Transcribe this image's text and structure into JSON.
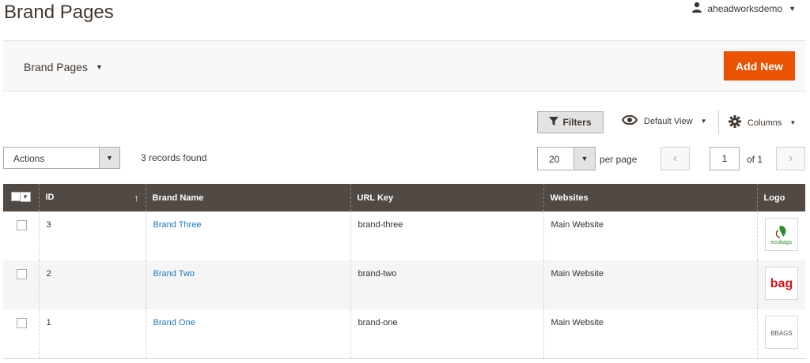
{
  "header": {
    "title": "Brand Pages",
    "username": "aheadworksdemo"
  },
  "page_actions": {
    "store_switcher_label": "Brand Pages",
    "add_new_label": "Add New"
  },
  "toolbar": {
    "filters_label": "Filters",
    "view_label": "Default View",
    "columns_label": "Columns",
    "actions_label": "Actions",
    "records_found": "3 records found",
    "per_page_value": "20",
    "per_page_label": "per page",
    "current_page": "1",
    "total_pages_label": "of 1"
  },
  "grid": {
    "columns": [
      "ID",
      "Brand Name",
      "URL Key",
      "Websites",
      "Logo"
    ],
    "rows": [
      {
        "id": "3",
        "brand_name": "Brand Three",
        "url_key": "brand-three",
        "websites": "Main Website",
        "logo_text": "ecobags"
      },
      {
        "id": "2",
        "brand_name": "Brand Two",
        "url_key": "brand-two",
        "websites": "Main Website",
        "logo_text": "bag"
      },
      {
        "id": "1",
        "brand_name": "Brand One",
        "url_key": "brand-one",
        "websites": "Main Website",
        "logo_text": "BBAGS"
      }
    ]
  },
  "colors": {
    "accent": "#eb5202",
    "grid_header": "#514943",
    "link": "#1979c3"
  }
}
